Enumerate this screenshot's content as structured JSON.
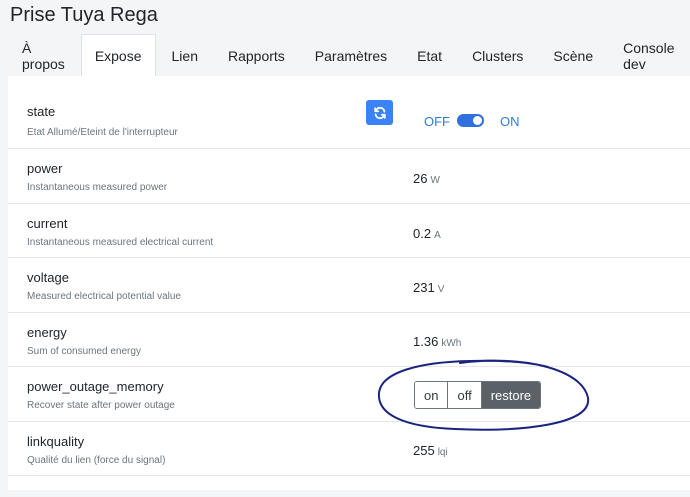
{
  "page": {
    "title": "Prise Tuya Rega"
  },
  "tabs": [
    "À propos",
    "Expose",
    "Lien",
    "Rapports",
    "Paramètres",
    "Etat",
    "Clusters",
    "Scène",
    "Console dev"
  ],
  "active_tab": "Expose",
  "rows": {
    "state": {
      "name": "state",
      "desc": "Etat Allumé/Eteint de l'interrupteur",
      "off_label": "OFF",
      "on_label": "ON",
      "switch_on": true
    },
    "power": {
      "name": "power",
      "desc": "Instantaneous measured power",
      "value": "26",
      "unit": "W"
    },
    "current": {
      "name": "current",
      "desc": "Instantaneous measured electrical current",
      "value": "0.2",
      "unit": "A"
    },
    "voltage": {
      "name": "voltage",
      "desc": "Measured electrical potential value",
      "value": "231",
      "unit": "V"
    },
    "energy": {
      "name": "energy",
      "desc": "Sum of consumed energy",
      "value": "1.36",
      "unit": "kWh"
    },
    "power_outage_memory": {
      "name": "power_outage_memory",
      "desc": "Recover state after power outage",
      "options": [
        "on",
        "off",
        "restore"
      ],
      "selected": "restore"
    },
    "linkquality": {
      "name": "linkquality",
      "desc": "Qualité du lien (force du signal)",
      "value": "255",
      "unit": "lqi"
    }
  },
  "colors": {
    "accent": "#2f6fde",
    "refresh_button": "#3b82f6",
    "annotation": "#1a237e"
  }
}
